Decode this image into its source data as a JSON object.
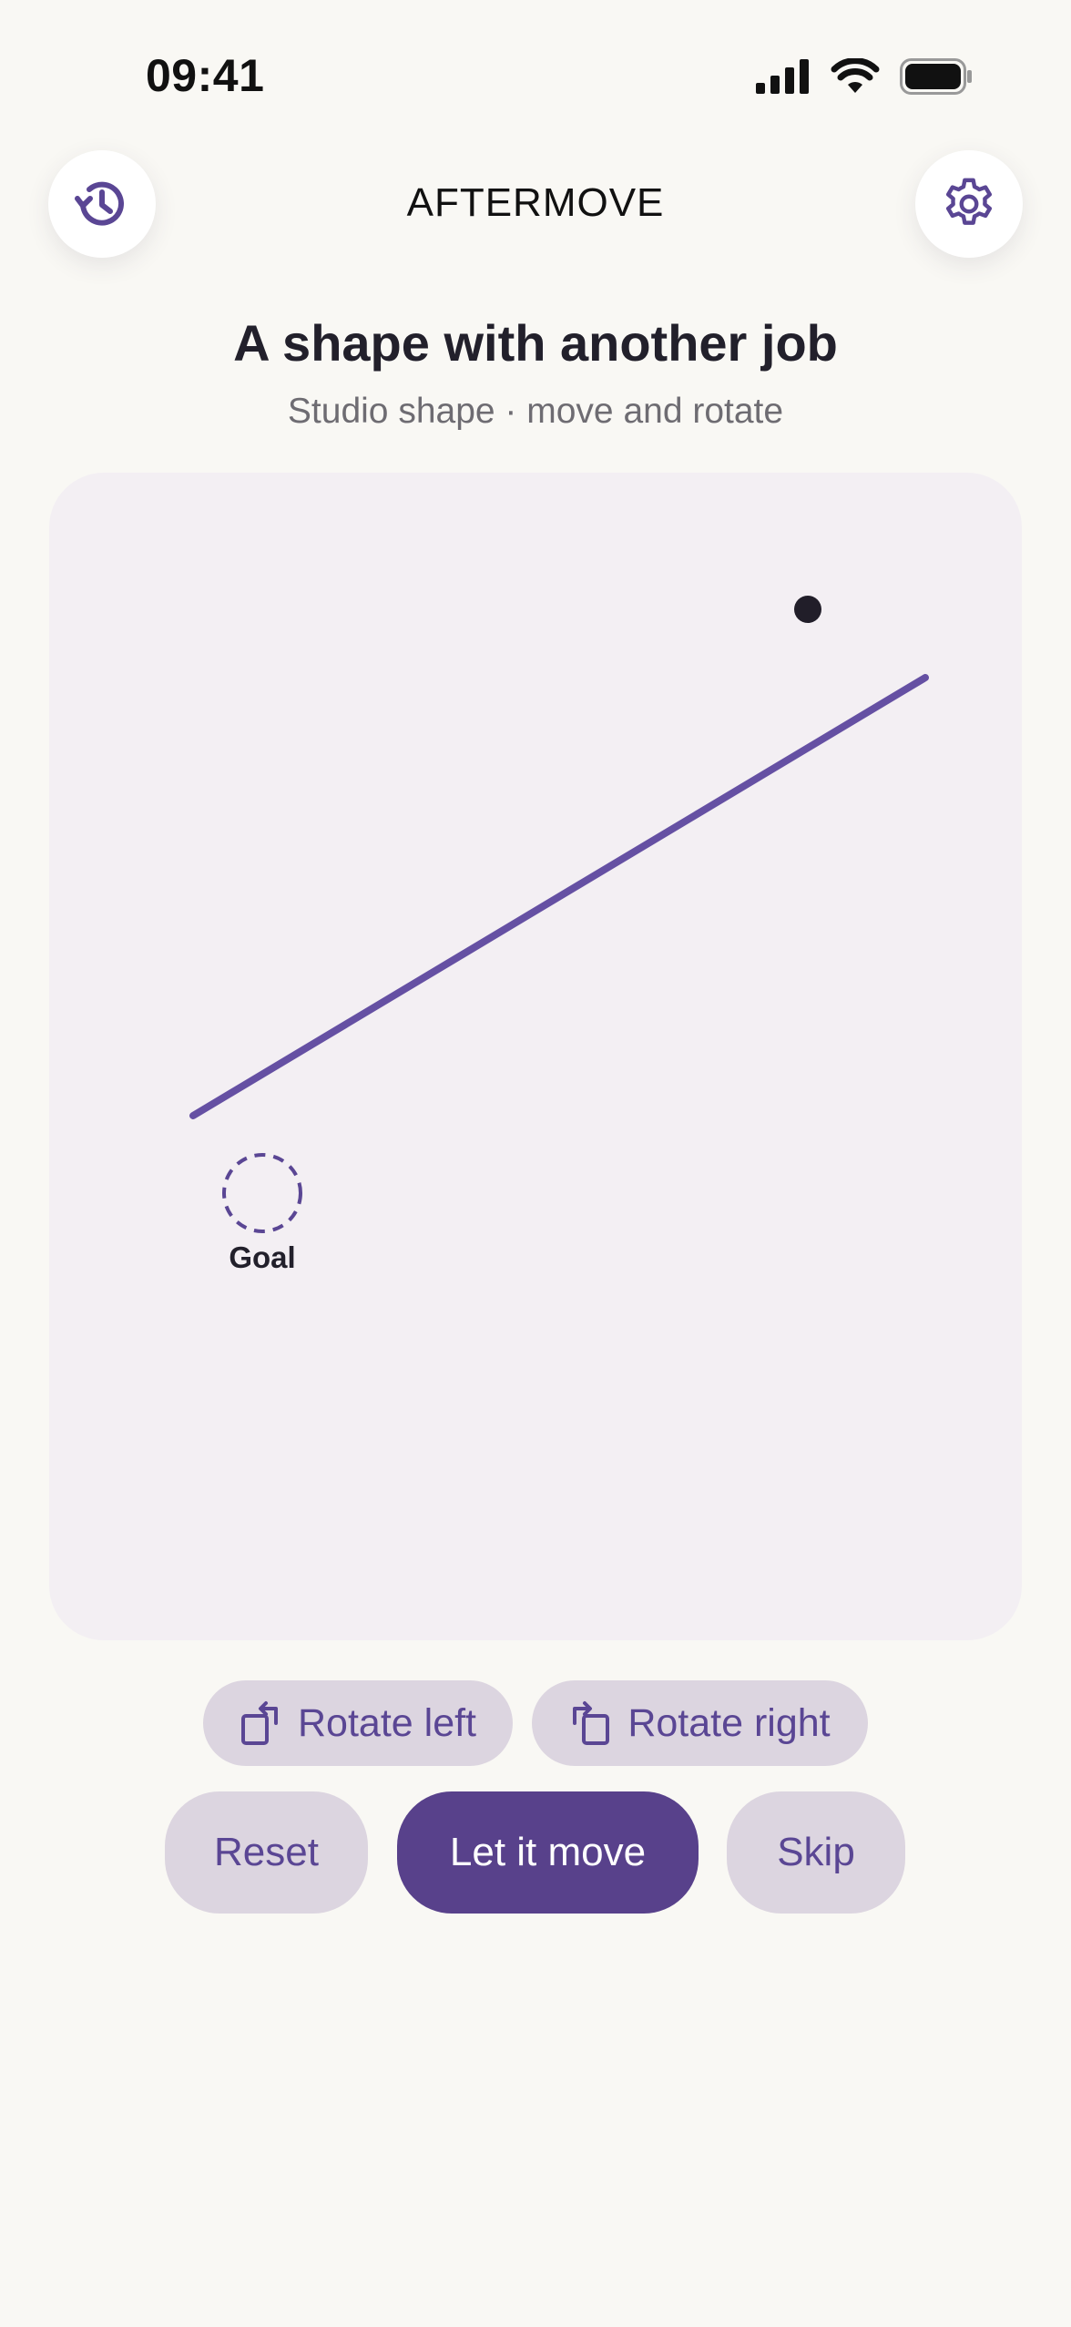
{
  "status_bar": {
    "time": "09:41",
    "icons": [
      "cellular-signal-icon",
      "wifi-icon",
      "battery-icon"
    ]
  },
  "header": {
    "title": "AFTERMOVE",
    "history_icon": "history-icon",
    "settings_icon": "gear-icon"
  },
  "puzzle": {
    "title": "A shape with another job",
    "subtitle": "Studio shape · move and rotate"
  },
  "board": {
    "goal_label": "Goal",
    "colors": {
      "background": "#f3eff3",
      "shape": "#6550a3",
      "ball": "#211e29",
      "goal": "#5a4694"
    }
  },
  "controls": {
    "rotate_left_label": "Rotate left",
    "rotate_right_label": "Rotate right",
    "reset_label": "Reset",
    "move_label": "Let it move",
    "skip_label": "Skip"
  },
  "colors": {
    "accent": "#58418b",
    "pill": "#dcd5e0",
    "page_background": "#f9f8f4"
  }
}
